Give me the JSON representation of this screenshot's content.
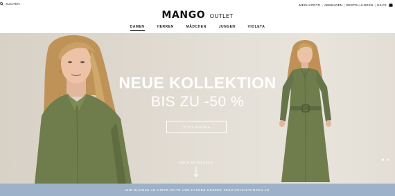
{
  "utility": {
    "search_label": "SUCHEN",
    "links": [
      "MEIN KONTO",
      "ABMELDEN",
      "BESTELLUNGEN",
      "HILFE"
    ]
  },
  "logo": {
    "brand": "MANGO",
    "sub": "OUTLET"
  },
  "nav": {
    "tabs": [
      {
        "label": "DAMEN",
        "active": true
      },
      {
        "label": "HERREN",
        "active": false
      },
      {
        "label": "MÄDCHEN",
        "active": false
      },
      {
        "label": "JUNGEN",
        "active": false
      },
      {
        "label": "VIOLETA",
        "active": false
      }
    ]
  },
  "hero": {
    "headline": "NEUE KOLLEKTION",
    "subheadline": "BIS ZU -50 %",
    "cta_label": "JETZT KAUFEN",
    "discover_label": "MEHR ENTDECKEN",
    "slides": 2,
    "active_slide": 1
  },
  "banner": {
    "text": "WIR BLEIBEN AN IHRER SEITE UND PASSEN UNSERE SERVICELEISTUNGEN AN"
  },
  "colors": {
    "hero_background": "#e0dad0",
    "dress": "#6f7d4c",
    "hair": "#c49a5a",
    "banner": "#9db2c9"
  },
  "icons": [
    "search-icon",
    "shopping-bag-icon",
    "arrow-down-icon"
  ]
}
